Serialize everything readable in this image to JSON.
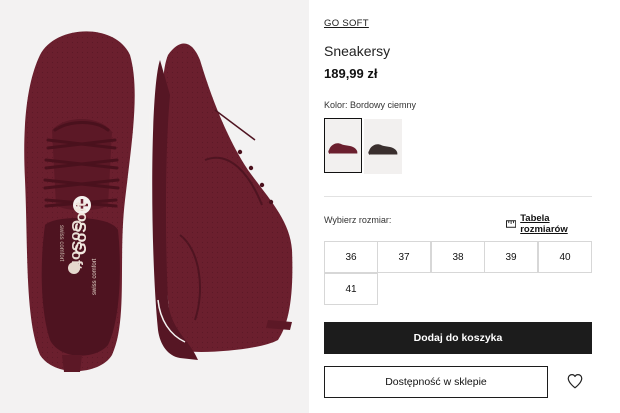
{
  "product": {
    "brand": "GO SOFT",
    "name": "Sneakersy",
    "price": "189,99 zł",
    "color_label": "Kolor: Bordowy ciemny",
    "shoe_color": "#6b1f2e"
  },
  "variants": [
    {
      "name": "bordowy",
      "selected": true,
      "color": "#6b1f2e"
    },
    {
      "name": "ciemny",
      "selected": false,
      "color": "#3a2f2e"
    }
  ],
  "size": {
    "label": "Wybierz rozmiar:",
    "table_link": "Tabela rozmiarów",
    "options": [
      "36",
      "37",
      "38",
      "39",
      "40",
      "41"
    ]
  },
  "actions": {
    "add_to_cart": "Dodaj do koszyka",
    "store_availability": "Dostępność w sklepie"
  },
  "gallery": {
    "insole_brand": "GoSoft",
    "insole_tagline": "swiss comfort"
  }
}
